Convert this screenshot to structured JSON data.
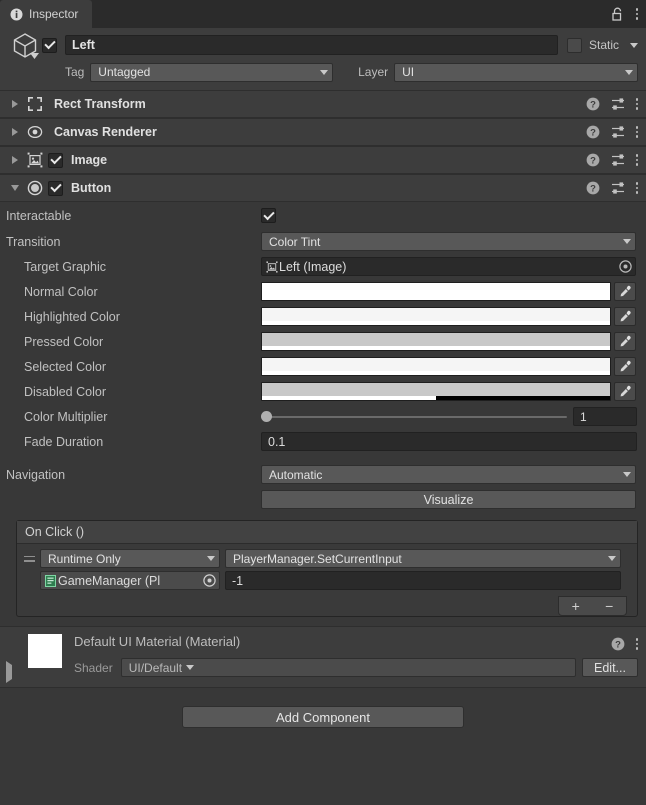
{
  "window": {
    "tab_label": "Inspector",
    "tab_icon": "info-icon",
    "lock_icon": "lock-open-icon",
    "menu_icon": "kebab-menu-icon"
  },
  "gameobject": {
    "icon": "cube-icon",
    "enabled": true,
    "name": "Left",
    "static_label": "Static",
    "static_checked": false,
    "tag_label": "Tag",
    "tag_value": "Untagged",
    "layer_label": "Layer",
    "layer_value": "UI"
  },
  "components": [
    {
      "title": "Rect Transform",
      "icon": "rect-transform-icon",
      "expanded": false,
      "has_checkbox": false,
      "checked": false
    },
    {
      "title": "Canvas Renderer",
      "icon": "canvas-renderer-icon",
      "expanded": false,
      "has_checkbox": false,
      "checked": false
    },
    {
      "title": "Image",
      "icon": "image-icon",
      "expanded": false,
      "has_checkbox": true,
      "checked": true
    },
    {
      "title": "Button",
      "icon": "button-icon",
      "expanded": true,
      "has_checkbox": true,
      "checked": true
    }
  ],
  "component_header_icons": {
    "help": "help-icon",
    "preset": "preset-icon",
    "menu": "kebab-menu-icon"
  },
  "button_component": {
    "interactable": {
      "label": "Interactable",
      "checked": true
    },
    "transition": {
      "label": "Transition",
      "value": "Color Tint"
    },
    "target_graphic": {
      "label": "Target Graphic",
      "value": "Left (Image)",
      "icon": "image-icon",
      "picker": "object-picker-icon"
    },
    "colors": [
      {
        "label": "Normal Color",
        "hex": "#FFFFFF",
        "alpha_pct": 100
      },
      {
        "label": "Highlighted Color",
        "hex": "#F5F5F5",
        "alpha_pct": 100
      },
      {
        "label": "Pressed Color",
        "hex": "#C8C8C8",
        "alpha_pct": 100
      },
      {
        "label": "Selected Color",
        "hex": "#F5F5F5",
        "alpha_pct": 100
      },
      {
        "label": "Disabled Color",
        "hex": "#C8C8C8",
        "alpha_pct": 50
      }
    ],
    "eyedropper_icon": "eyedropper-icon",
    "color_multiplier": {
      "label": "Color Multiplier",
      "value": "1",
      "slider_pct": 0
    },
    "fade_duration": {
      "label": "Fade Duration",
      "value": "0.1"
    },
    "navigation": {
      "label": "Navigation",
      "value": "Automatic"
    },
    "visualize_button": "Visualize"
  },
  "on_click": {
    "header": "On Click ()",
    "entries": [
      {
        "drag_handle": "drag-handle-icon",
        "timing": "Runtime Only",
        "function": "PlayerManager.SetCurrentInput",
        "object": "GameManager (Pl",
        "object_icon": "script-icon",
        "argument": "-1"
      }
    ],
    "add_label": "+",
    "remove_label": "−"
  },
  "material": {
    "title": "Default UI Material (Material)",
    "shader_label": "Shader",
    "shader_value": "UI/Default",
    "edit_label": "Edit...",
    "help_icon": "help-icon",
    "menu_icon": "kebab-menu-icon"
  },
  "footer": {
    "add_component": "Add Component"
  }
}
